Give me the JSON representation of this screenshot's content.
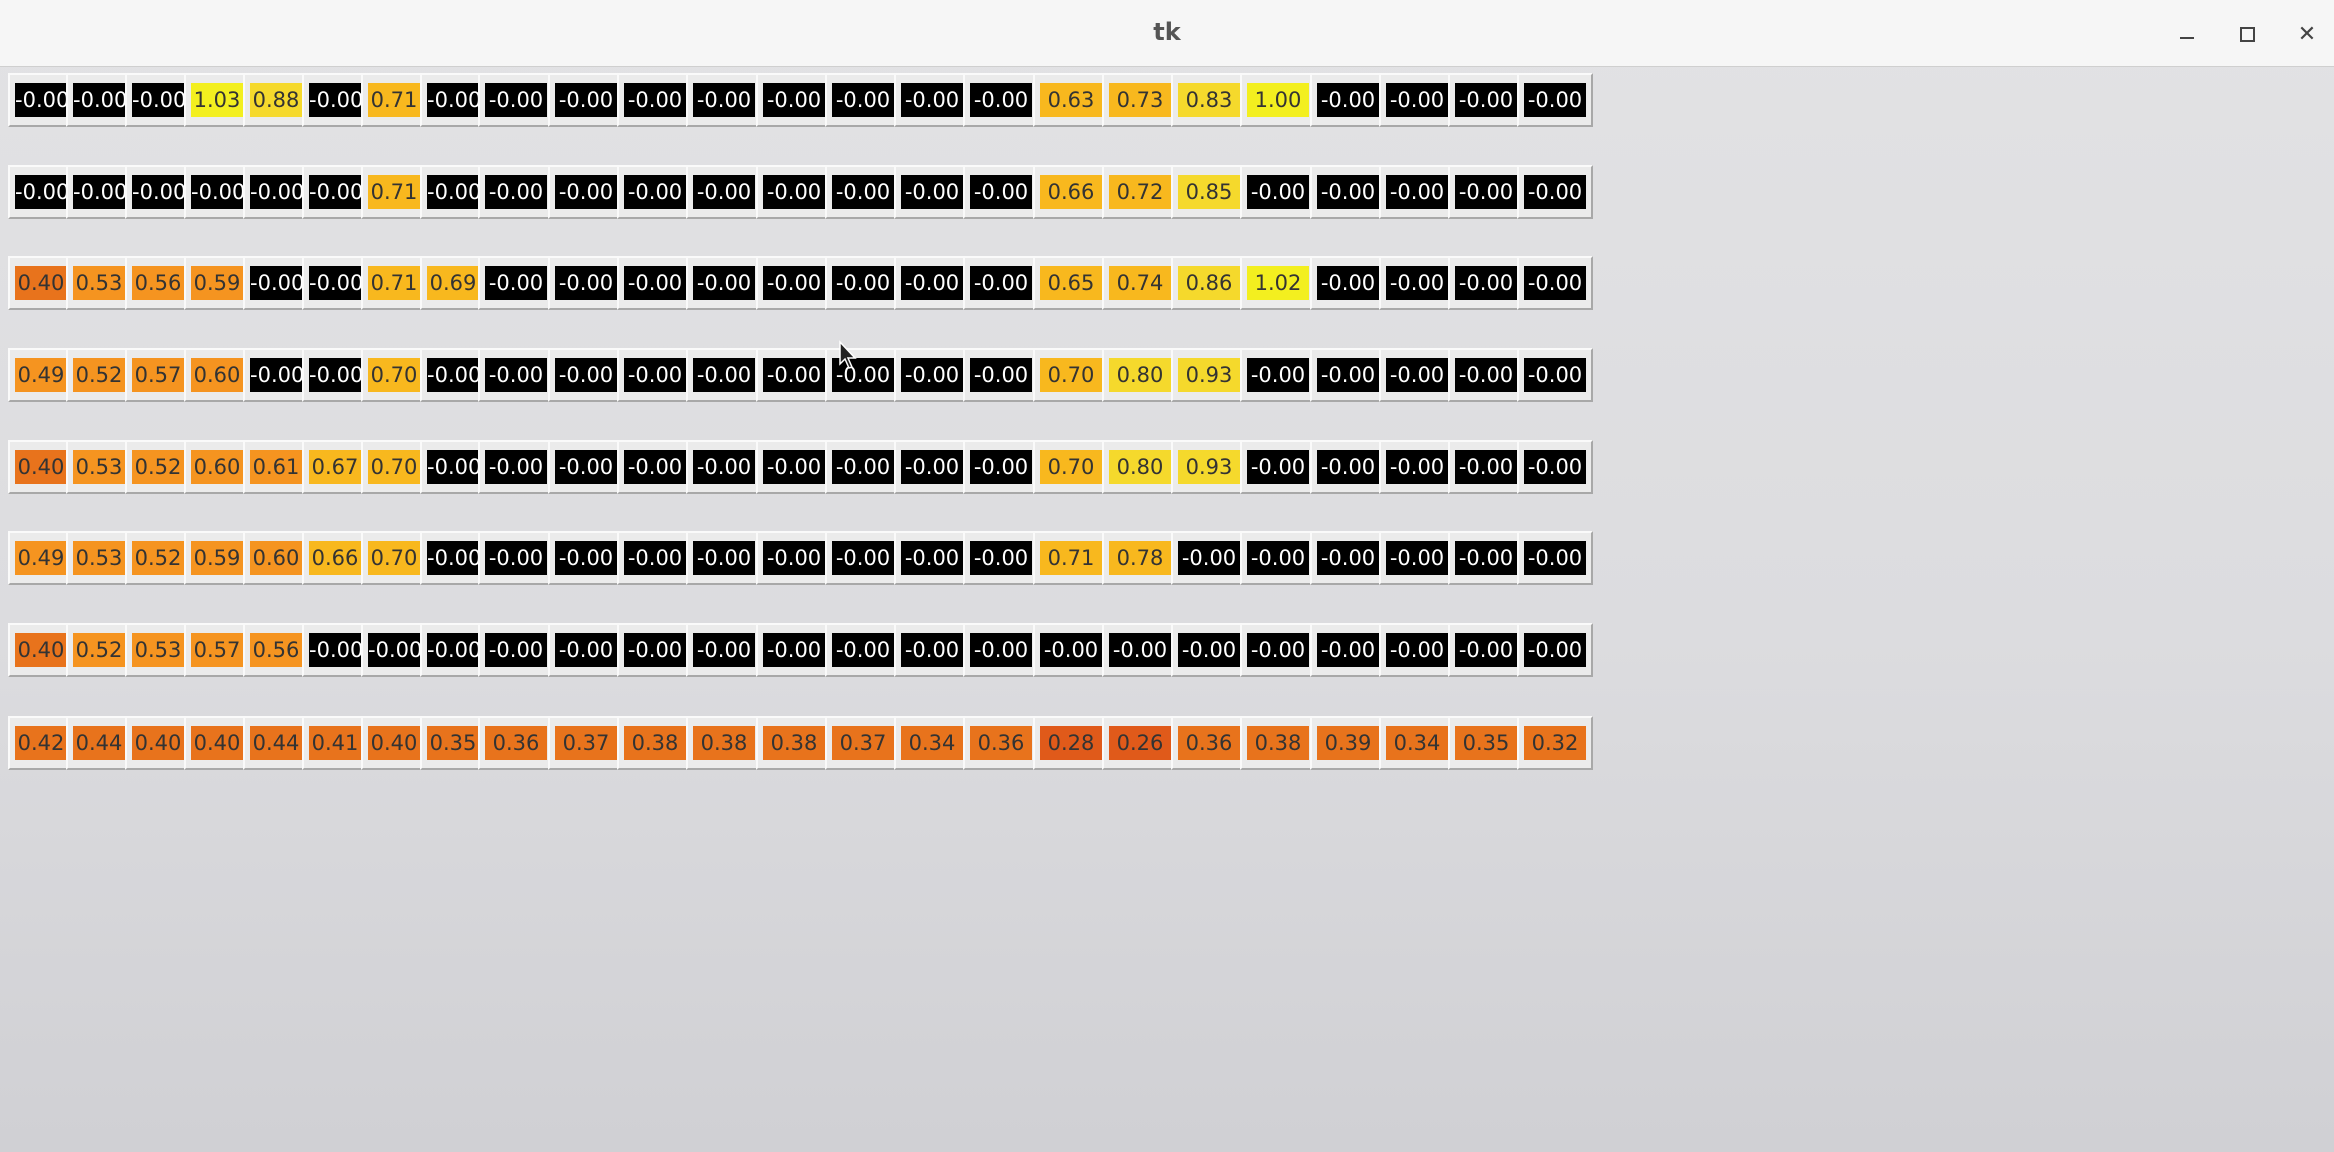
{
  "window": {
    "title": "tk",
    "controls": [
      "minimize-icon",
      "maximize-icon",
      "close-icon"
    ]
  },
  "palette": {
    "black": "#000000",
    "yellow": "#f3ef1f",
    "yellow_orange": "#f5d92c",
    "amber": "#f8b81e",
    "orange": "#f59420",
    "dark_orange": "#e8731c",
    "deep_orange": "#e05a1a",
    "text_light": "#ffffff",
    "text_dark": "#333333"
  },
  "grid": {
    "rows": [
      [
        "-0.00",
        "-0.00",
        "-0.00",
        "1.03",
        "0.88",
        "-0.00",
        "0.71",
        "-0.00",
        "-0.00",
        "-0.00",
        "-0.00",
        "-0.00",
        "-0.00",
        "-0.00",
        "-0.00",
        "-0.00",
        "0.63",
        "0.73",
        "0.83",
        "1.00",
        "-0.00",
        "-0.00",
        "-0.00",
        "-0.00"
      ],
      [
        "-0.00",
        "-0.00",
        "-0.00",
        "-0.00",
        "-0.00",
        "-0.00",
        "0.71",
        "-0.00",
        "-0.00",
        "-0.00",
        "-0.00",
        "-0.00",
        "-0.00",
        "-0.00",
        "-0.00",
        "-0.00",
        "0.66",
        "0.72",
        "0.85",
        "-0.00",
        "-0.00",
        "-0.00",
        "-0.00",
        "-0.00"
      ],
      [
        "0.40",
        "0.53",
        "0.56",
        "0.59",
        "-0.00",
        "-0.00",
        "0.71",
        "0.69",
        "-0.00",
        "-0.00",
        "-0.00",
        "-0.00",
        "-0.00",
        "-0.00",
        "-0.00",
        "-0.00",
        "0.65",
        "0.74",
        "0.86",
        "1.02",
        "-0.00",
        "-0.00",
        "-0.00",
        "-0.00"
      ],
      [
        "0.49",
        "0.52",
        "0.57",
        "0.60",
        "-0.00",
        "-0.00",
        "0.70",
        "-0.00",
        "-0.00",
        "-0.00",
        "-0.00",
        "-0.00",
        "-0.00",
        "-0.00",
        "-0.00",
        "-0.00",
        "0.70",
        "0.80",
        "0.93",
        "-0.00",
        "-0.00",
        "-0.00",
        "-0.00",
        "-0.00"
      ],
      [
        "0.40",
        "0.53",
        "0.52",
        "0.60",
        "0.61",
        "0.67",
        "0.70",
        "-0.00",
        "-0.00",
        "-0.00",
        "-0.00",
        "-0.00",
        "-0.00",
        "-0.00",
        "-0.00",
        "-0.00",
        "0.70",
        "0.80",
        "0.93",
        "-0.00",
        "-0.00",
        "-0.00",
        "-0.00",
        "-0.00"
      ],
      [
        "0.49",
        "0.53",
        "0.52",
        "0.59",
        "0.60",
        "0.66",
        "0.70",
        "-0.00",
        "-0.00",
        "-0.00",
        "-0.00",
        "-0.00",
        "-0.00",
        "-0.00",
        "-0.00",
        "-0.00",
        "0.71",
        "0.78",
        "-0.00",
        "-0.00",
        "-0.00",
        "-0.00",
        "-0.00",
        "-0.00"
      ],
      [
        "0.40",
        "0.52",
        "0.53",
        "0.57",
        "0.56",
        "-0.00",
        "-0.00",
        "-0.00",
        "-0.00",
        "-0.00",
        "-0.00",
        "-0.00",
        "-0.00",
        "-0.00",
        "-0.00",
        "-0.00",
        "-0.00",
        "-0.00",
        "-0.00",
        "-0.00",
        "-0.00",
        "-0.00",
        "-0.00",
        "-0.00"
      ],
      [
        "0.42",
        "0.44",
        "0.40",
        "0.40",
        "0.44",
        "0.41",
        "0.40",
        "0.35",
        "0.36",
        "0.37",
        "0.38",
        "0.38",
        "0.38",
        "0.37",
        "0.34",
        "0.36",
        "0.28",
        "0.26",
        "0.36",
        "0.38",
        "0.39",
        "0.34",
        "0.35",
        "0.32"
      ]
    ]
  }
}
